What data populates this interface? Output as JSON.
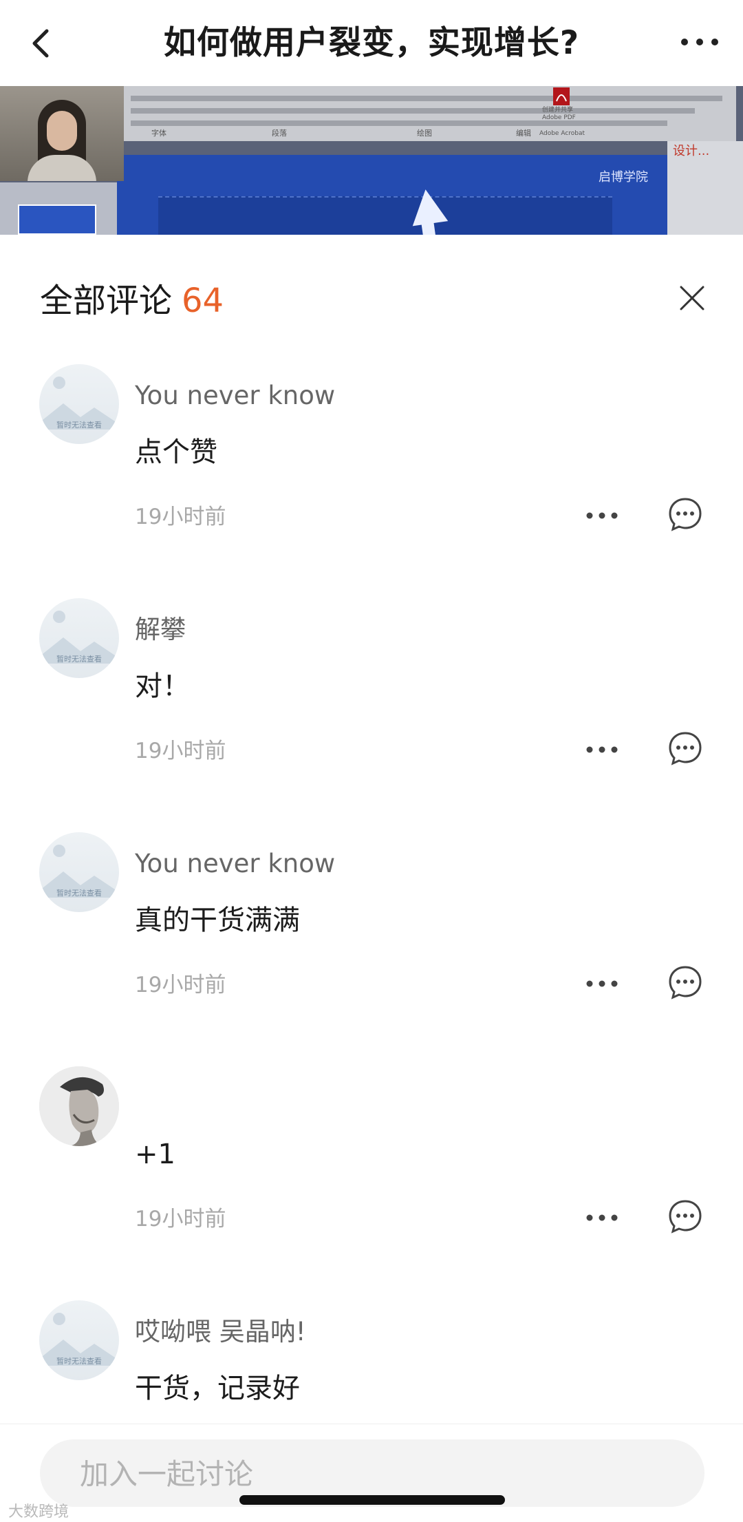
{
  "nav": {
    "title": "如何做用户裂变，实现增长?",
    "back_icon": "chevron-left-icon",
    "more_icon": "more-dots-icon"
  },
  "video": {
    "ribbon_labels": [
      "字体",
      "段落",
      "绘图",
      "编辑",
      "Adobe Acrobat"
    ],
    "pdf_button_label": "创建并共享 Adobe PDF",
    "slide_brand": "启博学院",
    "right_pane_title": "设计..."
  },
  "panel": {
    "title": "全部评论",
    "count": "64",
    "close_icon": "close-icon"
  },
  "comments": [
    {
      "author": "You never know",
      "content": "点个赞",
      "time": "19小时前",
      "avatar": "placeholder"
    },
    {
      "author": "解攀",
      "content": "对！",
      "time": "19小时前",
      "avatar": "placeholder"
    },
    {
      "author": "You never know",
      "content": "真的干货满满",
      "time": "19小时前",
      "avatar": "placeholder"
    },
    {
      "author": "",
      "content": "+1",
      "time": "19小时前",
      "avatar": "photo"
    },
    {
      "author": "哎呦喂 吴晶呐!",
      "content": "干货，记录好",
      "time": "",
      "avatar": "placeholder"
    }
  ],
  "avatar_placeholder_text": "暂时无法查看",
  "input": {
    "placeholder": "加入一起讨论"
  },
  "watermark": "大数跨境",
  "colors": {
    "accent": "#e8622a",
    "slide_blue": "#244bb0",
    "muted_text": "#a8a8a8"
  }
}
